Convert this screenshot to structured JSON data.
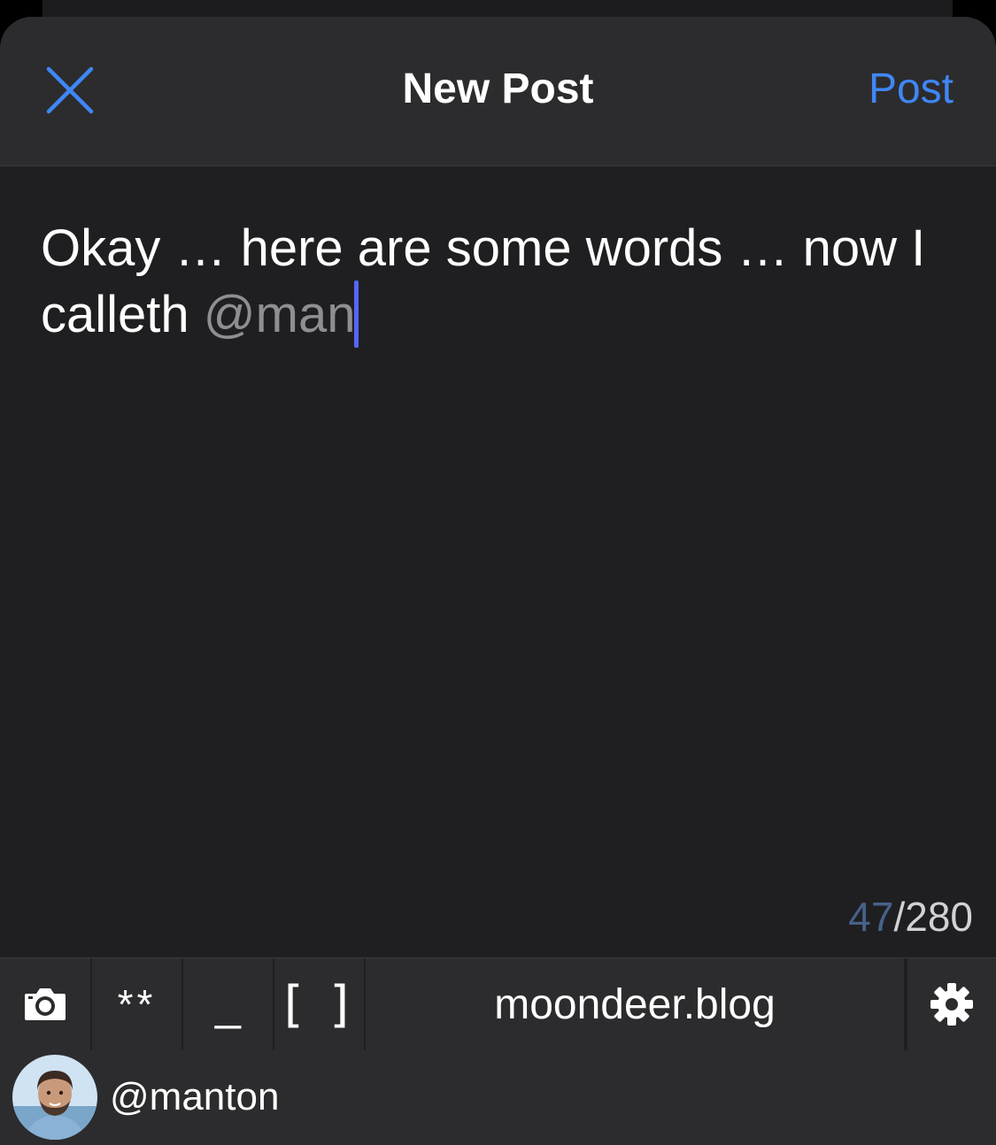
{
  "header": {
    "title": "New Post",
    "post_label": "Post"
  },
  "editor": {
    "text": "Okay … here are some words … now I calleth ",
    "mention": "@man"
  },
  "counter": {
    "count": "47",
    "limit": "/280"
  },
  "toolbar": {
    "bold_label": "**",
    "italic_label": "_",
    "link_label": "[ ]",
    "site": "moondeer.blog"
  },
  "account": {
    "username": "@manton"
  },
  "colors": {
    "accent": "#3f87f5",
    "cursor": "#5566ff",
    "background": "#1f1f21",
    "bar": "#2c2c2e"
  },
  "icons": {
    "close": "close-icon",
    "camera": "camera-icon",
    "settings": "gear-icon"
  }
}
